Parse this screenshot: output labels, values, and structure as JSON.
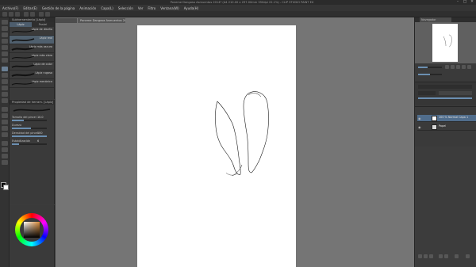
{
  "window": {
    "title": "Poneme Dangosa Asmuentos 2014* (A4 210.00 x 297.00mm 350dpi 22.1%) - CLIP STUDIO PAINT EX",
    "controls": [
      "minimize-icon",
      "maximize-icon",
      "close-icon"
    ]
  },
  "menu": {
    "items": [
      "Archivo(F)",
      "Editar(E)",
      "Gestión de la página",
      "Animación",
      "Capa(L)",
      "Selección",
      "Ver",
      "Filtro",
      "Ventana(W)",
      "Ayuda(H)"
    ]
  },
  "canvas": {
    "doc_tab": "Poneme Dangosa Asmuentos 2014*"
  },
  "subtool": {
    "header": "Subherramienta [Lápiz]",
    "tabs": [
      "Lápiz",
      "Pastel"
    ],
    "brushes": [
      {
        "label": "Lápiz de diseño",
        "selected": false
      },
      {
        "label": "Lápiz real",
        "selected": true
      },
      {
        "label": "Lápiz más oscuro",
        "selected": false
      },
      {
        "label": "Lápiz más claro",
        "selected": false
      },
      {
        "label": "Lápiz de color",
        "selected": false
      },
      {
        "label": "Lápiz rugoso",
        "selected": false
      },
      {
        "label": "Lápiz mecánico",
        "selected": false
      }
    ]
  },
  "toolprop": {
    "header": "Propiedad de herram. [Lápiz]",
    "rows": [
      {
        "label": "Tamaño del pincel",
        "value": "10.0",
        "fill": 0.35
      },
      {
        "label": "Dureza",
        "value": "",
        "fill": 0.55
      },
      {
        "label": "Densidad del pincel",
        "value": "100",
        "fill": 1.0
      },
      {
        "label": "Estabilización",
        "value": "6",
        "fill": 0.2
      }
    ]
  },
  "navigator": {
    "tab": "Navegador"
  },
  "layers": {
    "rows": [
      {
        "name": "100 % Normal Capa 1",
        "selected": true,
        "folder": false
      },
      {
        "name": "Papel",
        "selected": false,
        "folder": true
      }
    ]
  },
  "colors": {
    "background": "#3c3c3c",
    "canvas_bg": "#757575",
    "paper": "#ffffff",
    "selection": "#506d8c"
  }
}
